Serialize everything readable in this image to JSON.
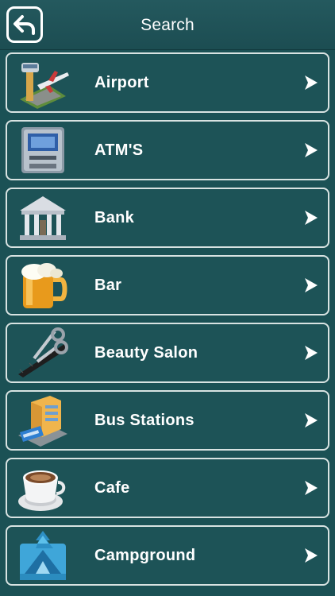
{
  "header": {
    "title": "Search",
    "back_icon": "back-arrow-icon"
  },
  "items": [
    {
      "label": "Airport",
      "icon": "airport-icon"
    },
    {
      "label": "ATM'S",
      "icon": "atm-icon"
    },
    {
      "label": "Bank",
      "icon": "bank-icon"
    },
    {
      "label": "Bar",
      "icon": "beer-mug-icon"
    },
    {
      "label": "Beauty Salon",
      "icon": "scissors-comb-icon"
    },
    {
      "label": "Bus Stations",
      "icon": "bus-station-icon"
    },
    {
      "label": "Cafe",
      "icon": "coffee-cup-icon"
    },
    {
      "label": "Campground",
      "icon": "campground-icon"
    }
  ],
  "colors": {
    "background": "#1b5155",
    "row_border": "#d8e3e2",
    "text": "#ffffff"
  }
}
